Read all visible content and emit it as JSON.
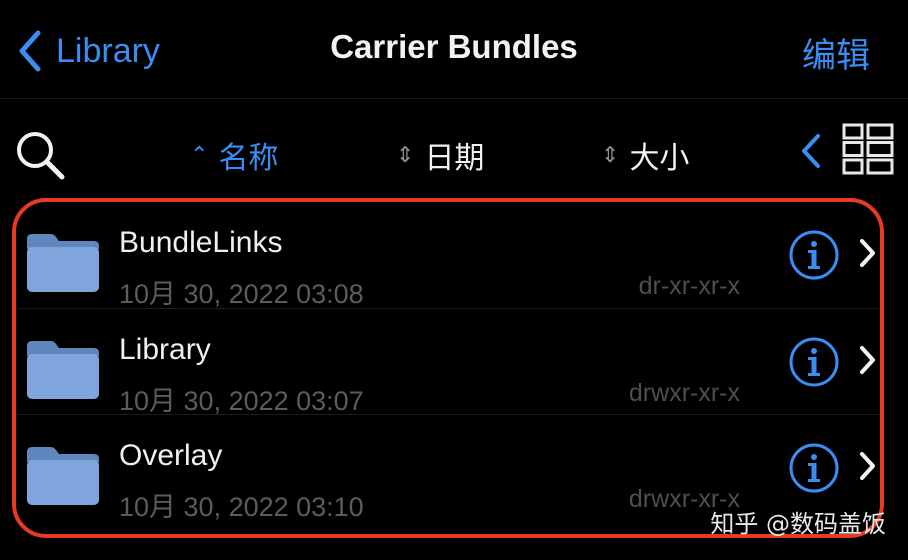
{
  "nav": {
    "back_label": "Library",
    "title": "Carrier Bundles",
    "edit_label": "编辑"
  },
  "sort_bar": {
    "items": [
      {
        "label": "名称",
        "indicator": "⌃",
        "active": true
      },
      {
        "label": "日期",
        "indicator": "⇕",
        "active": false
      },
      {
        "label": "大小",
        "indicator": "⇕",
        "active": false
      }
    ]
  },
  "files": [
    {
      "name": "BundleLinks",
      "date": "10月 30, 2022 03:08",
      "permissions": "dr-xr-xr-x",
      "icon": "folder-icon"
    },
    {
      "name": "Library",
      "date": "10月 30, 2022 03:07",
      "permissions": "drwxr-xr-x",
      "icon": "folder-icon"
    },
    {
      "name": "Overlay",
      "date": "10月 30, 2022 03:10",
      "permissions": "drwxr-xr-x",
      "icon": "folder-icon"
    }
  ],
  "watermark": "知乎 @数码盖饭",
  "colors": {
    "background": "#000000",
    "accent": "#3a8ef3",
    "highlight_border": "#e83a27",
    "folder": "#7fa5dc",
    "secondary_text": "#5b5b60"
  }
}
